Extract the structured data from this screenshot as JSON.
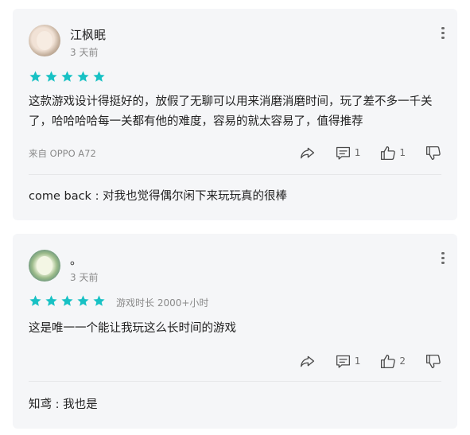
{
  "reviews": [
    {
      "username": "江枫眠",
      "date": "3 天前",
      "rating": 5,
      "playtime": "",
      "content": "这款游戏设计得挺好的，放假了无聊可以用来消磨消磨时间，玩了差不多一千关了，哈哈哈哈每一关都有他的难度，容易的就太容易了，值得推荐",
      "device": "来自 OPPO A72",
      "comments_count": "1",
      "likes_count": "1",
      "reply": "come back : 对我也觉得偶尔闲下来玩玩真的很棒"
    },
    {
      "username": "。",
      "date": "3 天前",
      "rating": 5,
      "playtime": "游戏时长 2000+小时",
      "content": "这是唯一一个能让我玩这么长时间的游戏",
      "device": "",
      "comments_count": "1",
      "likes_count": "2",
      "reply": "知鸢 : 我也是"
    }
  ],
  "icons": {
    "more": "more-vertical-icon",
    "star": "star-icon",
    "share": "share-icon",
    "comment": "comment-icon",
    "like": "thumbs-up-icon",
    "dislike": "thumbs-down-icon"
  },
  "colors": {
    "star": "#17c1c4",
    "card_bg": "#f5f6f8",
    "muted_text": "#8a8a8a"
  }
}
